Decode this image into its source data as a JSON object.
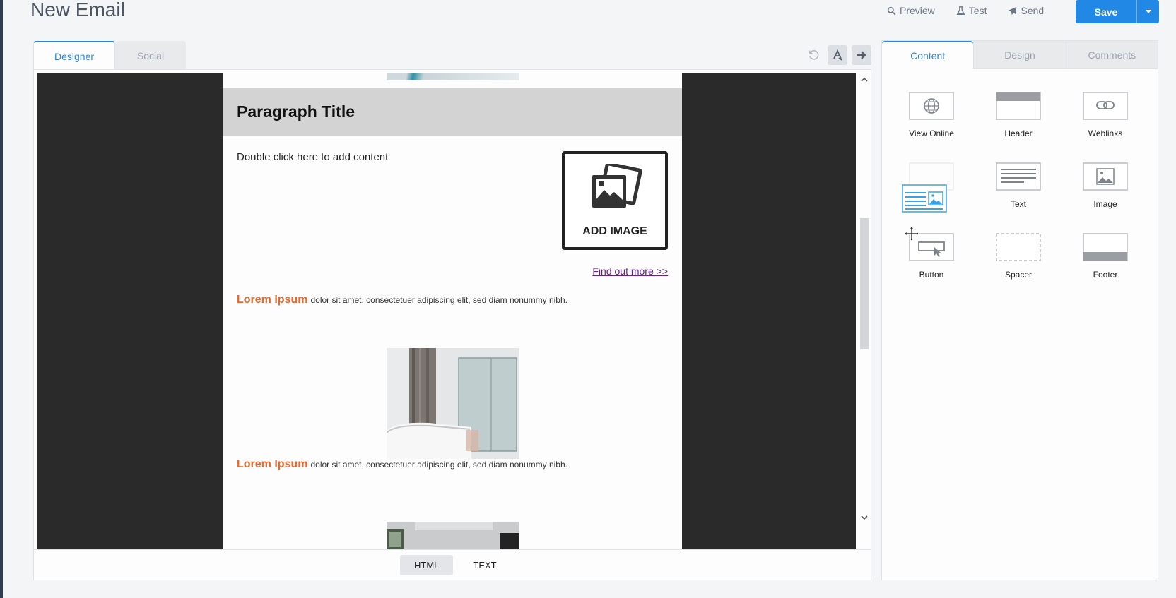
{
  "header": {
    "title": "New Email",
    "actions": [
      {
        "label": "Preview",
        "icon": "search-icon"
      },
      {
        "label": "Test",
        "icon": "flask-icon"
      },
      {
        "label": "Send",
        "icon": "paper-plane-icon"
      }
    ],
    "save_label": "Save"
  },
  "designer": {
    "tabs": [
      {
        "label": "Designer",
        "active": true
      },
      {
        "label": "Social",
        "active": false
      }
    ],
    "toolbar": [
      "undo-icon",
      "font-style-icon",
      "arrow-right-icon"
    ],
    "email": {
      "paragraph_title": "Paragraph Title",
      "content_placeholder": "Double click here to add content",
      "add_image_label": "ADD IMAGE",
      "find_more": "Find out more >>",
      "items": [
        {
          "heading": "Lorem Ipsum",
          "text": "dolor sit amet, consectetuer adipiscing elit, sed diam  nonummy nibh."
        },
        {
          "heading": "Lorem Ipsum",
          "text": "dolor sit amet, consectetuer adipiscing elit, sed diam  nonummy nibh."
        }
      ]
    },
    "modes": [
      {
        "label": "HTML",
        "active": true
      },
      {
        "label": "TEXT",
        "active": false
      }
    ]
  },
  "sidebar": {
    "tabs": [
      {
        "label": "Content",
        "active": true
      },
      {
        "label": "Design",
        "active": false
      },
      {
        "label": "Comments",
        "active": false
      }
    ],
    "blocks": [
      {
        "label": "View Online",
        "icon": "globe-icon"
      },
      {
        "label": "Header",
        "icon": "header-block-icon"
      },
      {
        "label": "Weblinks",
        "icon": "link-icon"
      },
      {
        "label": "",
        "icon": "text-image-block-icon"
      },
      {
        "label": "Text",
        "icon": "text-block-icon"
      },
      {
        "label": "Image",
        "icon": "image-block-icon"
      },
      {
        "label": "Button",
        "icon": "button-block-icon"
      },
      {
        "label": "Spacer",
        "icon": "spacer-block-icon"
      },
      {
        "label": "Footer",
        "icon": "footer-block-icon"
      }
    ]
  },
  "colors": {
    "accent": "#2188e6",
    "tab_active": "#2f84d6",
    "lorem_heading": "#e8672b",
    "link_visited": "#6a1f8f",
    "drag_ghost": "#3aa3e6"
  }
}
